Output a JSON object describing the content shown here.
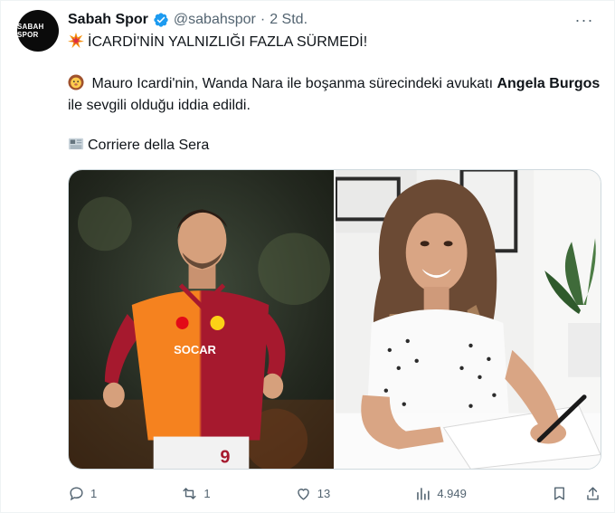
{
  "author": {
    "display_name": "Sabah Spor",
    "handle": "@sabahspor",
    "separator": "·",
    "timestamp": "2 Std.",
    "avatar_text": "SABAH SPOR"
  },
  "tweet": {
    "headline": "İCARDİ'NİN YALNIZLIĞI FAZLA SÜRMEDİ!",
    "para_before": " Mauro Icardi'nin, Wanda Nara ile boşanma sürecindeki avukatı ",
    "para_bold": "Angela Burgos",
    "para_after": " ile sevgili olduğu iddia edildi.",
    "source": "Corriere della Sera"
  },
  "media": {
    "photo_left_alt": "Mauro Icardi in Galatasaray kit",
    "photo_right_alt": "Angela Burgos signing document",
    "kit_sponsor": "SOCAR",
    "shirt_number": "9"
  },
  "actions": {
    "reply_count": "1",
    "retweet_count": "1",
    "like_count": "13",
    "view_count": "4.949"
  },
  "colors": {
    "text_primary": "#0f1419",
    "text_secondary": "#536471",
    "verified_blue": "#1d9bf0",
    "galatasaray_red": "#a6192e",
    "galatasaray_orange": "#f5821f"
  },
  "icons": [
    "verified-badge-icon",
    "more-options-icon",
    "explosion-emoji",
    "lion-emoji",
    "newspaper-emoji",
    "reply-icon",
    "retweet-icon",
    "like-icon",
    "views-icon",
    "bookmark-icon",
    "share-icon"
  ]
}
